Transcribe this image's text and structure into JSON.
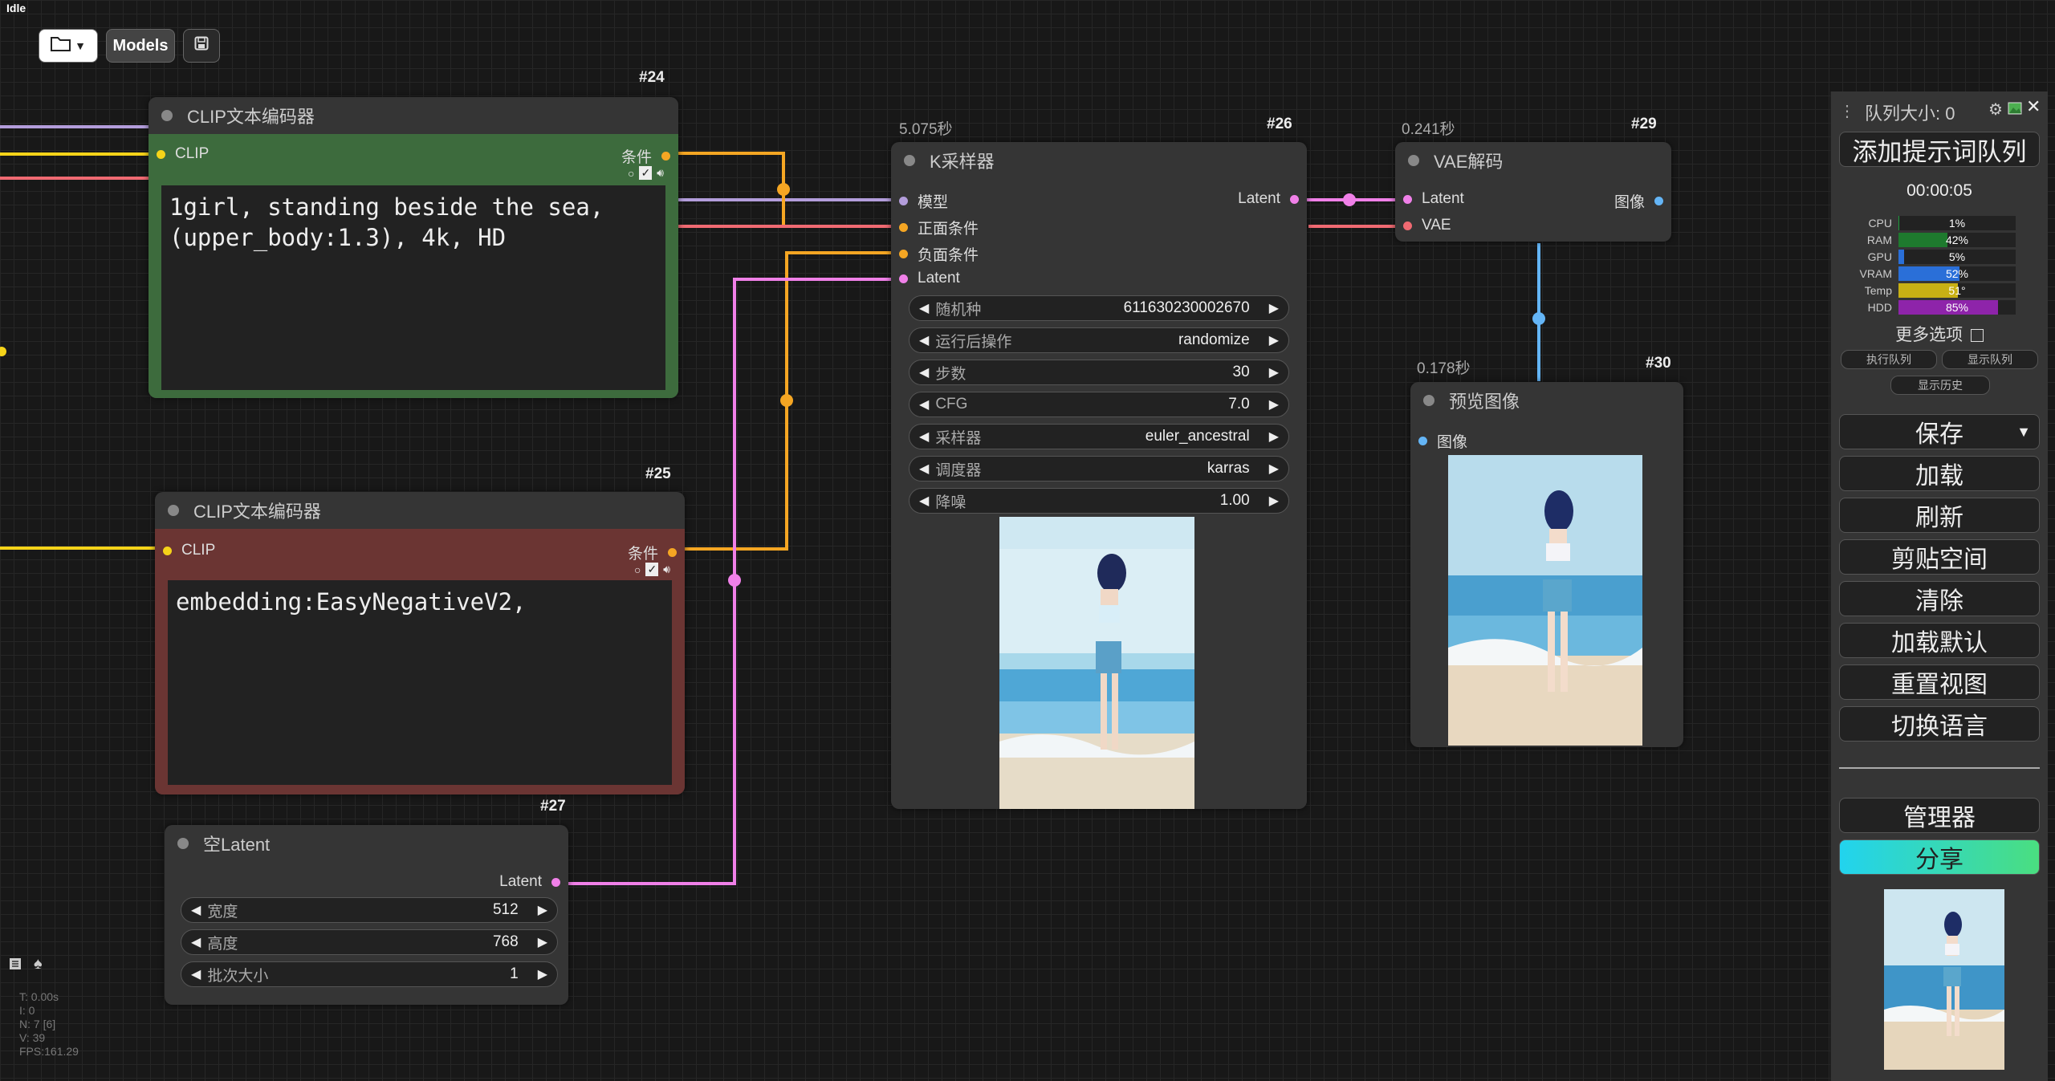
{
  "status": "Idle",
  "toolbar": {
    "models_label": "Models"
  },
  "nodes": {
    "n24": {
      "id": "#24",
      "title": "CLIP文本编码器",
      "input": "CLIP",
      "output": "条件",
      "text": "1girl, standing beside the sea,\n(upper_body:1.3), 4k, HD",
      "color": "#3d6b3d"
    },
    "n25": {
      "id": "#25",
      "title": "CLIP文本编码器",
      "input": "CLIP",
      "output": "条件",
      "text": "embedding:EasyNegativeV2,",
      "color": "#6b3533"
    },
    "n27": {
      "id": "#27",
      "title": "空Latent",
      "output": "Latent",
      "widgets": [
        {
          "label": "宽度",
          "value": "512"
        },
        {
          "label": "高度",
          "value": "768"
        },
        {
          "label": "批次大小",
          "value": "1"
        }
      ]
    },
    "n26": {
      "id": "#26",
      "title": "K采样器",
      "time": "5.075秒",
      "inputs": [
        "模型",
        "正面条件",
        "负面条件",
        "Latent"
      ],
      "output": "Latent",
      "widgets": [
        {
          "label": "随机种",
          "value": "611630230002670"
        },
        {
          "label": "运行后操作",
          "value": "randomize"
        },
        {
          "label": "步数",
          "value": "30"
        },
        {
          "label": "CFG",
          "value": "7.0"
        },
        {
          "label": "采样器",
          "value": "euler_ancestral"
        },
        {
          "label": "调度器",
          "value": "karras"
        },
        {
          "label": "降噪",
          "value": "1.00"
        }
      ]
    },
    "n29": {
      "id": "#29",
      "title": "VAE解码",
      "time": "0.241秒",
      "inputs": [
        "Latent",
        "VAE"
      ],
      "output": "图像"
    },
    "n30": {
      "id": "#30",
      "title": "预览图像",
      "time": "0.178秒",
      "input": "图像"
    }
  },
  "panel": {
    "queue_size": "队列大小: 0",
    "queue_prompt": "添加提示词队列",
    "timer": "00:00:05",
    "resources": [
      {
        "label": "CPU",
        "value": "1%",
        "pct": 1,
        "color": "#1e9e3e"
      },
      {
        "label": "RAM",
        "value": "42%",
        "pct": 42,
        "color": "#1e7a2e"
      },
      {
        "label": "GPU",
        "value": "5%",
        "pct": 5,
        "color": "#2a6fd8"
      },
      {
        "label": "VRAM",
        "value": "52%",
        "pct": 52,
        "color": "#2a6fd8"
      },
      {
        "label": "Temp",
        "value": "51°",
        "pct": 51,
        "color": "#c8b014"
      },
      {
        "label": "HDD",
        "value": "85%",
        "pct": 85,
        "color": "#8e24aa"
      }
    ],
    "more_options": "更多选项",
    "exec_queue": "执行队列",
    "show_queue": "显示队列",
    "show_history": "显示历史",
    "buttons": [
      "保存",
      "加载",
      "刷新",
      "剪贴空间",
      "清除",
      "加载默认",
      "重置视图",
      "切换语言"
    ],
    "manager": "管理器",
    "share": "分享"
  },
  "stats": [
    "T: 0.00s",
    "I: 0",
    "N: 7 [6]",
    "V: 39",
    "FPS:161.29"
  ]
}
